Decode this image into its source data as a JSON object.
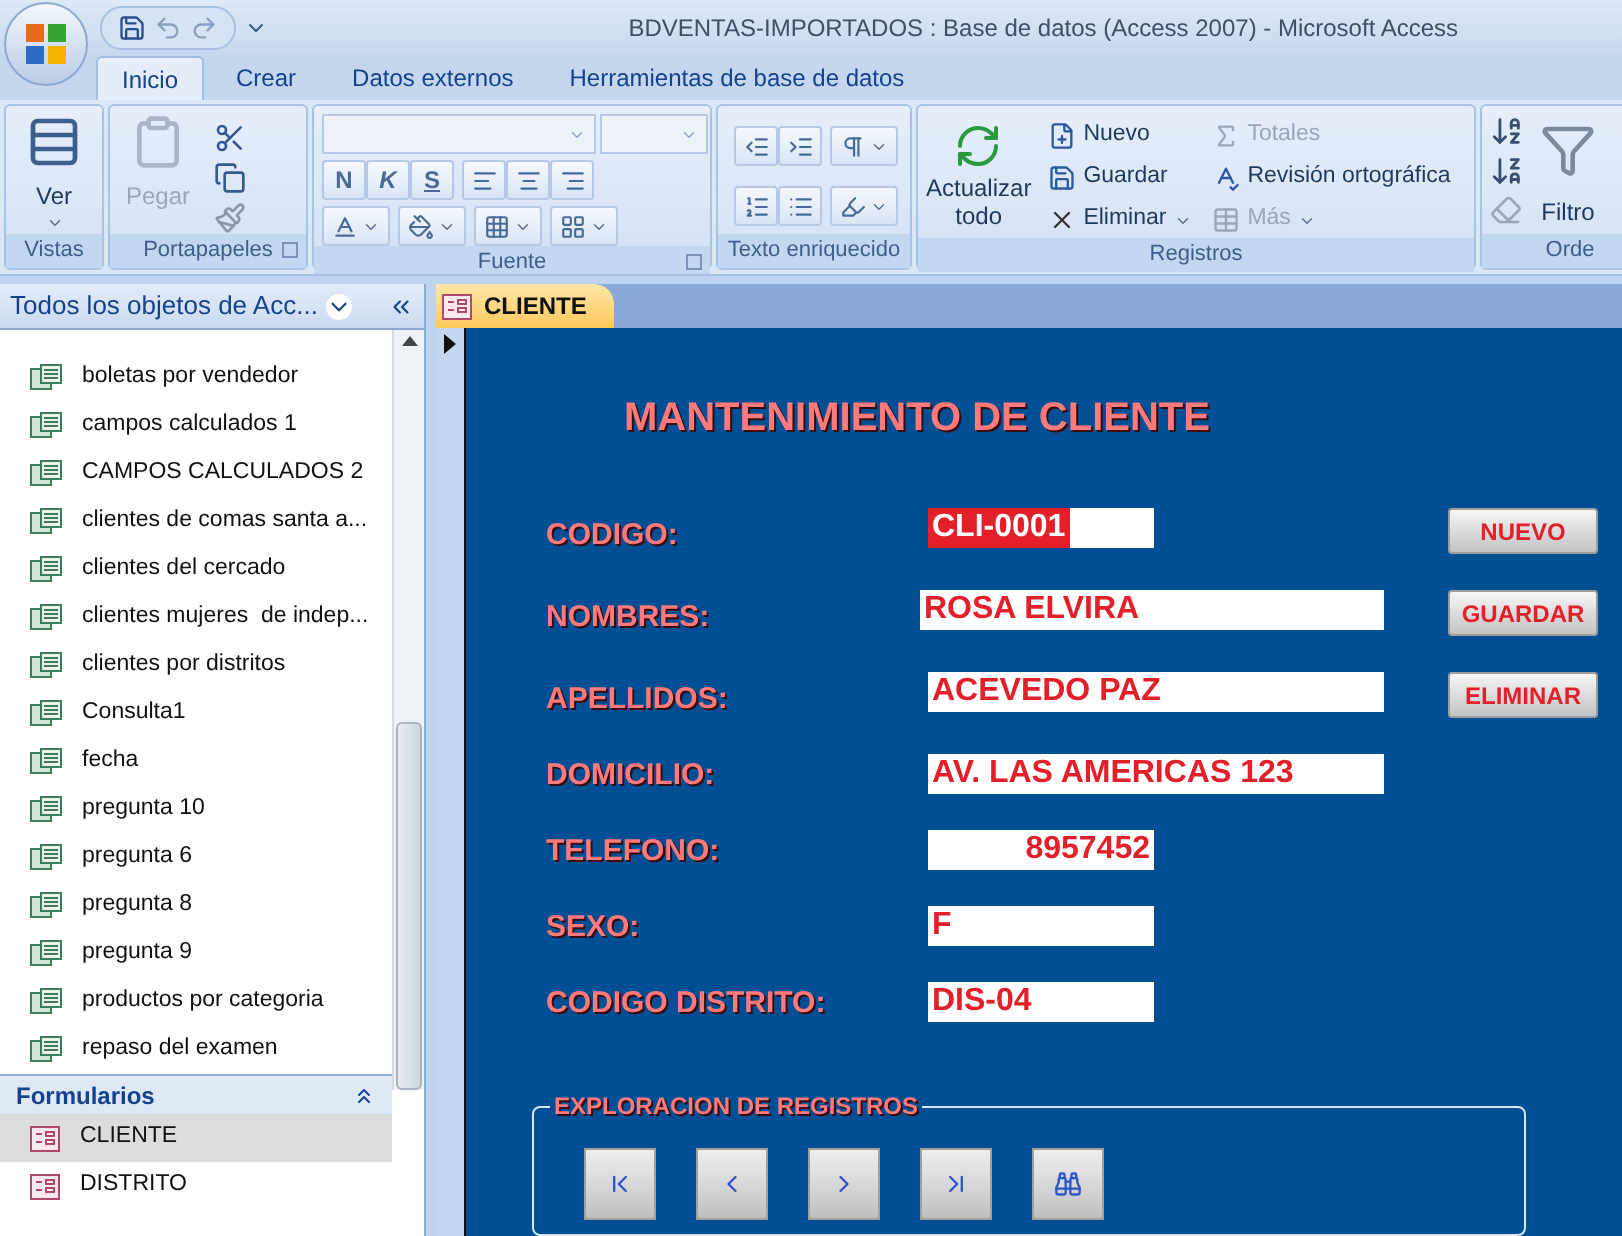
{
  "window": {
    "title": "BDVENTAS-IMPORTADOS : Base de datos (Access 2007) - Microsoft Access"
  },
  "ribbon_tabs": [
    {
      "label": "Inicio",
      "selected": true
    },
    {
      "label": "Crear",
      "selected": false
    },
    {
      "label": "Datos externos",
      "selected": false
    },
    {
      "label": "Herramientas de base de datos",
      "selected": false
    }
  ],
  "ribbon": {
    "vistas": {
      "label": "Vistas",
      "ver": "Ver"
    },
    "portapapeles": {
      "label": "Portapapeles",
      "pegar": {
        "label": "Pegar",
        "disabled": true
      }
    },
    "fuente": {
      "label": "Fuente",
      "format_buttons": [
        "N",
        "K",
        "S"
      ]
    },
    "texto_enriquecido": {
      "label": "Texto enriquecido"
    },
    "registros": {
      "label": "Registros",
      "actualizar": "Actualizar todo",
      "commands": [
        {
          "label": "Nuevo",
          "disabled": false
        },
        {
          "label": "Guardar",
          "disabled": false
        },
        {
          "label": "Eliminar",
          "disabled": false
        },
        {
          "label": "Totales",
          "disabled": true
        },
        {
          "label": "Revisión ortográfica",
          "disabled": false
        },
        {
          "label": "Más",
          "disabled": true
        }
      ]
    },
    "orden": {
      "label": "Orde",
      "filtro": "Filtro"
    }
  },
  "navigation_pane": {
    "title": "Todos los objetos de Acc...",
    "items": [
      {
        "label": "boletas por vendedor",
        "selected": false
      },
      {
        "label": "campos calculados 1",
        "selected": false
      },
      {
        "label": "CAMPOS CALCULADOS 2",
        "selected": false
      },
      {
        "label": "clientes de comas santa a...",
        "selected": false
      },
      {
        "label": "clientes del cercado",
        "selected": false
      },
      {
        "label": "clientes mujeres  de indep...",
        "selected": false
      },
      {
        "label": "clientes por distritos",
        "selected": false
      },
      {
        "label": "Consulta1",
        "selected": false
      },
      {
        "label": "fecha",
        "selected": false
      },
      {
        "label": "pregunta 10",
        "selected": false
      },
      {
        "label": "pregunta 6",
        "selected": false
      },
      {
        "label": "pregunta 8",
        "selected": false
      },
      {
        "label": "pregunta 9",
        "selected": false
      },
      {
        "label": "productos por categoria",
        "selected": false
      },
      {
        "label": "repaso del examen",
        "selected": false
      }
    ],
    "section": {
      "label": "Formularios",
      "items": [
        {
          "label": "CLIENTE",
          "selected": true
        },
        {
          "label": "DISTRITO",
          "selected": false
        }
      ]
    }
  },
  "document_tab": {
    "label": "CLIENTE",
    "selected": true
  },
  "form": {
    "title": "MANTENIMIENTO DE CLIENTE",
    "fields": [
      {
        "label": "CODIGO:",
        "value": "CLI-0001",
        "selected": true
      },
      {
        "label": "NOMBRES:",
        "value": "ROSA ELVIRA",
        "selected": false
      },
      {
        "label": "APELLIDOS:",
        "value": "ACEVEDO PAZ",
        "selected": false
      },
      {
        "label": "DOMICILIO:",
        "value": "AV. LAS AMERICAS 123",
        "selected": false
      },
      {
        "label": "TELEFONO:",
        "value": "8957452",
        "selected": false
      },
      {
        "label": "SEXO:",
        "value": "F",
        "selected": false
      },
      {
        "label": "CODIGO DISTRITO:",
        "value": "DIS-04",
        "selected": false
      }
    ],
    "buttons": [
      "NUEVO",
      "GUARDAR",
      "ELIMINAR"
    ],
    "navigation": {
      "legend": "EXPLORACION DE REGISTROS"
    }
  }
}
